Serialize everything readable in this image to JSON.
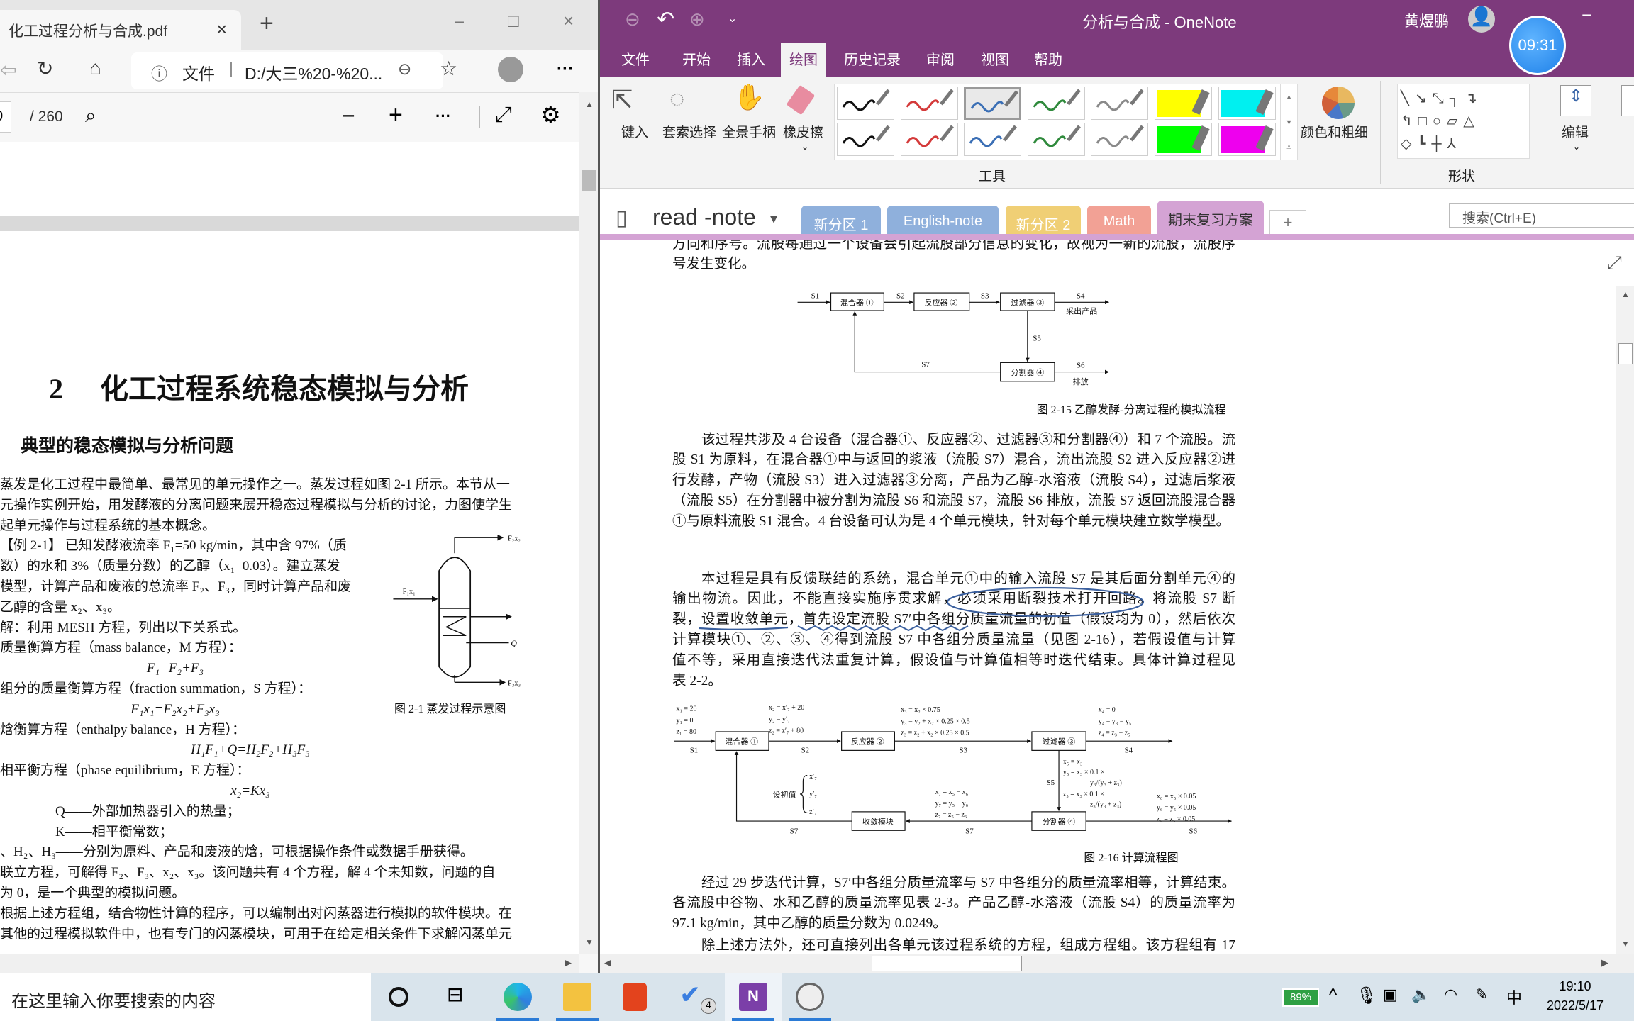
{
  "edge": {
    "tab_title": "化工过程分析与合成.pdf",
    "tab_close": "×",
    "new_tab": "+",
    "window_controls": {
      "minimize": "−",
      "maximize": "□",
      "close": "×"
    },
    "address": {
      "info_icon": "ⓘ",
      "scheme_label": "文件",
      "separator": "|",
      "url": "D:/大三%20-%20..."
    },
    "more": "···",
    "pdf_toolbar": {
      "page_input": "0",
      "page_total": "/ 260",
      "zoom_out": "−",
      "zoom_in": "+",
      "more": "···"
    },
    "pdf": {
      "chapter_number": "2",
      "chapter_title": "化工过程系统稳态模拟与分析",
      "section_title": "典型的稳态模拟与分析问题",
      "lines": [
        "蒸发是化工过程中最简单、最常见的单元操作之一。蒸发过程如图 2-1 所示。本节从一",
        "元操作实例开始，用发酵液的分离问题来展开稳态过程模拟与分析的讨论，力图使学生",
        "起单元操作与过程系统的基本概念。",
        "【例 2-1】 已知发酵液流率 F₁=50 kg/min，其中含 97%（质",
        "数）的水和 3%（质量分数）的乙醇（x₁=0.03）。建立蒸发",
        "模型，计算产品和废液的总流率 F₂、F₃，同时计算产品和废",
        "乙醇的含量 x₂、x₃。",
        "解：利用 MESH 方程，列出以下关系式。",
        "质量衡算方程（mass balance，M 方程）：",
        "F₁=F₂+F₃",
        "组分的质量衡算方程（fraction summation，S 方程）：",
        "F₁x₁=F₂x₂+F₃x₃",
        "焓衡算方程（enthalpy balance，H 方程）：",
        "H₁F₁+Q=H₂F₂+H₃F₃",
        "相平衡方程（phase equilibrium，E 方程）：",
        "x₂=Kx₃",
        "Q——外部加热器引入的热量；",
        "K——相平衡常数；",
        "、H₂、H₃——分别为原料、产品和废液的焓，可根据操作条件或数据手册获得。",
        "联立方程，可解得 F₂、F₃、x₂、x₃。该问题共有 4 个方程，解 4 个未知数，问题的自",
        "为 0，是一个典型的模拟问题。",
        "根据上述方程组，结合物性计算的程序，可以编制出对闪蒸器进行模拟的软件模块。在",
        "其他的过程模拟软件中，也有专门的闪蒸模块，可用于在给定相关条件下求解闪蒸单元"
      ],
      "figure": {
        "top_stream": "F₂x₂",
        "feed_stream": "F₁x₁",
        "heat": "Q",
        "bottom_stream": "F₃x₃",
        "caption": "图 2-1   蒸发过程示意图"
      }
    }
  },
  "onenote": {
    "window_title": "分析与合成 - OneNote",
    "user_name": "黄煜鹏",
    "minimize": "−",
    "timer": "09:31",
    "menu": [
      "文件",
      "开始",
      "插入",
      "绘图",
      "历史记录",
      "审阅",
      "视图",
      "帮助"
    ],
    "active_menu": "绘图",
    "ribbon": {
      "tools": [
        "键入",
        "套索选择",
        "全景手柄",
        "橡皮擦"
      ],
      "pens_row1": [
        "#111111",
        "#d43a3a",
        "#3b6fb5",
        "#2f8a3c",
        "#8a8a8a",
        "#ffff00",
        "#00f0f0"
      ],
      "pens_row2": [
        "#111111",
        "#d43a3a",
        "#3b6fb5",
        "#2f8a3c",
        "#8a8a8a",
        "#00ff00",
        "#ee00ee"
      ],
      "selected_pen": "blue-row1",
      "color_thickness": "颜色和粗细",
      "group_tools": "工具",
      "group_shapes": "形状",
      "edit": "编辑"
    },
    "notebook": {
      "name": "read -note",
      "dropdown": "▾"
    },
    "sections": [
      {
        "label": "新分区 1",
        "color": "#8fb0dc"
      },
      {
        "label": "English-note",
        "color": "#8fb0dc"
      },
      {
        "label": "新分区 2",
        "color": "#f0cf75"
      },
      {
        "label": "Math",
        "color": "#f2a195"
      },
      {
        "label": "期末复习方案",
        "color": "#d4a3d4"
      }
    ],
    "add_section": "+",
    "search_placeholder": "搜索(Ctrl+E)",
    "page": {
      "paragraphs": [
        [
          "方向和序号。流股每通过一个设备会引起流股部分信息的变化，故视为一新的流股，流股序",
          "号发生变化。"
        ],
        [
          "该过程共涉及 4 台设备（混合器①、反应器②、过滤器③和分割器④）和 7 个流股。流",
          "股 S1 为原料，在混合器①中与返回的浆液（流股 S7）混合，流出流股 S2 进入反应器②进",
          "行发酵，产物（流股 S3）进入过滤器③分离，产品为乙醇-水溶液（流股 S4），过滤后浆液",
          "（流股 S5）在分割器中被分割为流股 S6 和流股 S7，流股 S6 排放，流股 S7 返回流股混合器",
          "①与原料流股 S1 混合。4 台设备可认为是 4 个单元模块，针对每个单元模块建立数学模型。"
        ],
        [
          "本过程是具有反馈联结的系统，混合单元①中的输入流股 S7 是其后面分割单元④的",
          "输出物流。因此，不能直接实施序贯求解，必须采用断裂技术打开回路。将流股 S7 断",
          "裂，设置收敛单元，首先设定流股 S7′中各组分质量流量的初值（假设均为 0），然后依次",
          "计算模块①、②、③、④得到流股 S7 中各组分质量流量（见图 2-16），若假设值与计算",
          "值不等，采用直接迭代法重复计算，假设值与计算值相等时迭代结束。具体计算过程见",
          "表 2-2。"
        ],
        [
          "经过 29 步迭代计算，S7′中各组分质量流率与 S7 中各组分的质量流率相等，计算结束。",
          "各流股中谷物、水和乙醇的质量流率见表 2-3。产品乙醇-水溶液（流股 S4）的质量流率为",
          "97.1 kg/min，其中乙醇的质量分数为 0.0249。"
        ],
        [
          "除上述方法外，还可直接列出各单元该过程系统的方程，组成方程组。该方程组有 17"
        ]
      ],
      "fig15": {
        "units": [
          "混合器 ①",
          "反应器 ②",
          "过滤器 ③",
          "分割器 ④"
        ],
        "streams": [
          "S1",
          "S2",
          "S3",
          "S4",
          "S5",
          "S6",
          "S7"
        ],
        "product_label": "采出产品",
        "discharge_label": "排放",
        "caption": "图 2-15   乙醇发酵-分离过程的模拟流程"
      },
      "fig16": {
        "units": [
          "混合器 ①",
          "反应器 ②",
          "过滤器 ③",
          "分割器 ④",
          "收敛模块"
        ],
        "streams": [
          "S1",
          "S2",
          "S3",
          "S4",
          "S5",
          "S6",
          "S7",
          "S7′"
        ],
        "eq_s1": [
          "x₁ = 20",
          "y₁ = 0",
          "z₁ = 80"
        ],
        "eq_s2": [
          "x₂ = x′₇ + 20",
          "y₂ = y′₇",
          "z₂ = z′₇ + 80"
        ],
        "eq_s3": [
          "x₃ = x₂ × 0.75",
          "y₃ = y₂ + x₂ × 0.25 × 0.5",
          "z₃ = z₂ + x₂ × 0.25 × 0.5"
        ],
        "eq_s4": [
          "x₄ = 0",
          "y₄ = y₃ − y₅",
          "z₄ = z₃ − z₅"
        ],
        "eq_s5": [
          "x₅ = x₃",
          "y₅ = x₃ × 0.1 ×",
          "y₃/(y₃ + z₃)",
          "z₅ = x₃ × 0.1 ×",
          "z₃/(y₃ + z₃)"
        ],
        "eq_s6": [
          "x₆ = x₅ × 0.05",
          "y₆ = y₅ × 0.05",
          "z₆ = z₅ × 0.05"
        ],
        "eq_s7": [
          "x₇ = x₅ − x₆",
          "y₇ = y₅ − y₆",
          "z₇ = z₅ − z₆"
        ],
        "init_label": "设初值",
        "init_vars": [
          "x′₇",
          "y′₇",
          "z′₇"
        ],
        "caption": "图 2-16   计算流程图"
      },
      "annotation_color": "#3a5f9e"
    }
  },
  "taskbar": {
    "search_placeholder": "在这里输入你要搜索的内容",
    "todo_badge": "4",
    "battery_percent": "89%",
    "ime": "中",
    "time": "19:10",
    "date": "2022/5/17"
  }
}
